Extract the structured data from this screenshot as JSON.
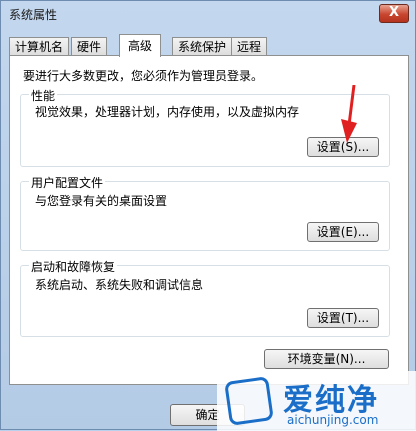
{
  "window": {
    "title": "系统属性",
    "close_label": "X"
  },
  "tabs": [
    {
      "label": "计算机名"
    },
    {
      "label": "硬件"
    },
    {
      "label": "高级"
    },
    {
      "label": "系统保护"
    },
    {
      "label": "远程"
    }
  ],
  "intro": "要进行大多数更改，您必须作为管理员登录。",
  "performance": {
    "title": "性能",
    "desc": "视觉效果，处理器计划，内存使用，以及虚拟内存",
    "button": "设置(S)..."
  },
  "profile": {
    "title": "用户配置文件",
    "desc": "与您登录有关的桌面设置",
    "button": "设置(E)..."
  },
  "startup": {
    "title": "启动和故障恢复",
    "desc": "系统启动、系统失败和调试信息",
    "button": "设置(T)..."
  },
  "env_button": "环境变量(N)...",
  "ok_button": "确定",
  "watermark": {
    "name": "爱纯净",
    "url": "aichunjing.com"
  },
  "colors": {
    "arrow": "#e02020",
    "watermark": "#1a6ec8"
  }
}
